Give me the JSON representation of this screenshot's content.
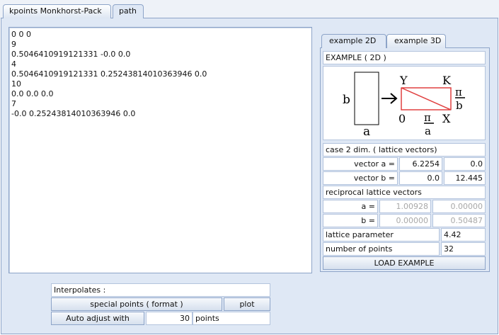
{
  "tabs": [
    {
      "label": "kpoints Monkhorst-Pack",
      "active": false
    },
    {
      "label": "path",
      "active": true
    }
  ],
  "path_text": [
    "0 0 0",
    "9",
    "0.5046410919121331 -0.0 0.0",
    "4",
    "0.5046410919121331 0.25243814010363946 0.0",
    "10",
    "0.0 0.0 0.0",
    "7",
    "-0.0 0.25243814010363946 0.0"
  ],
  "example_tabs": [
    {
      "label": "example 2D",
      "active": true
    },
    {
      "label": "example 3D",
      "active": false
    }
  ],
  "example": {
    "title": "EXAMPLE ( 2D )",
    "figure": {
      "left_label": "b",
      "bottom_label": "a",
      "corner_Y": "Y",
      "corner_K": "K",
      "corner_0": "0",
      "corner_X": "X",
      "pi_symbol": "π",
      "den_b": "b",
      "den_a": "a"
    },
    "case_label": "case 2 dim.  ( lattice vectors)",
    "vector_a_label": "vector a =",
    "vector_a_x": "6.2254",
    "vector_a_y": "0.0",
    "vector_b_label": "vector b =",
    "vector_b_x": "0.0",
    "vector_b_y": "12.445",
    "reciprocal_label": "reciprocal lattice vectors",
    "recip_a_label": "a =",
    "recip_a_x": "1.00928",
    "recip_a_y": "0.00000",
    "recip_b_label": "b =",
    "recip_b_x": "0.00000",
    "recip_b_y": "0.50487",
    "lattice_param_label": "lattice parameter",
    "lattice_param_value": "4.42",
    "num_points_label": "number of points",
    "num_points_value": "32",
    "load_button": "LOAD EXAMPLE"
  },
  "bottom": {
    "interpolates_label": "Interpolates :",
    "special_points_button": "special points ( format )",
    "plot_button": "plot",
    "auto_adjust_button": "Auto adjust with",
    "auto_adjust_value": "30",
    "points_label": "points"
  },
  "colors": {
    "panel_bg": "#dfe8f5",
    "border": "#8da4c8",
    "path_red": "#e04040"
  }
}
